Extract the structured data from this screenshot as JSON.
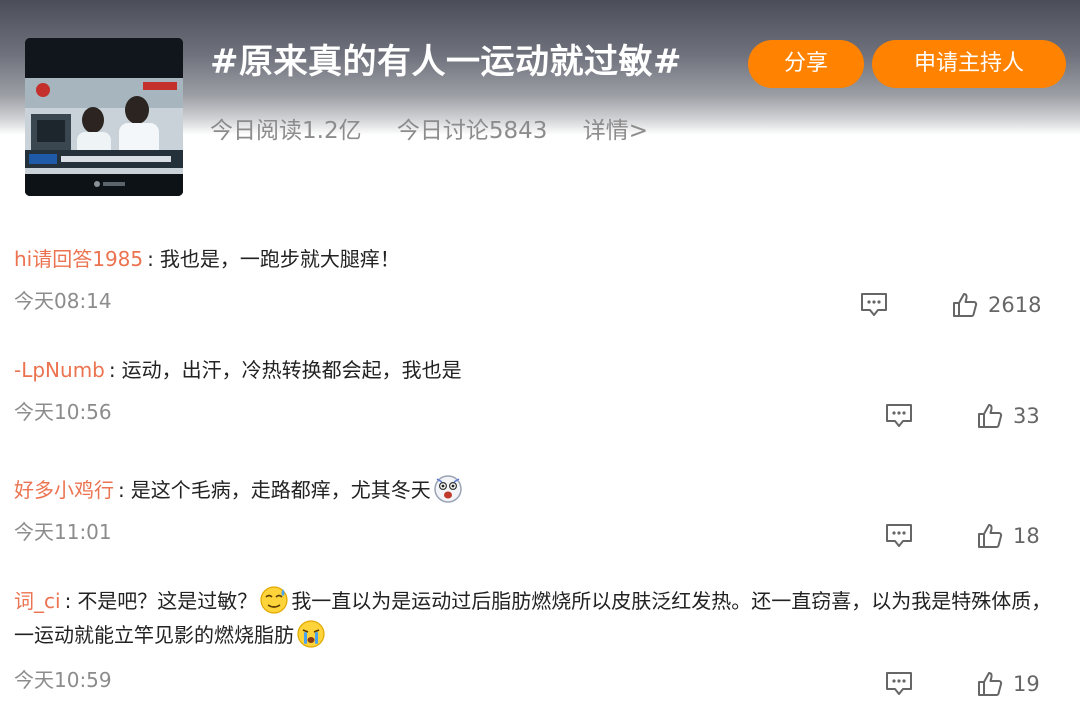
{
  "topic": {
    "title": "#原来真的有人一运动就过敏#",
    "share_label": "分享",
    "apply_host_label": "申请主持人",
    "stats": {
      "reads": "今日阅读1.2亿",
      "discussions": "今日讨论5843",
      "details": "详情>"
    }
  },
  "comments": [
    {
      "user": "hi请回答1985",
      "text": "我也是，一跑步就大腿痒！",
      "time": "今天08:14",
      "likes": "2618"
    },
    {
      "user": "-LpNumb",
      "text": "运动，出汗，冷热转换都会起，我也是",
      "time": "今天10:56",
      "likes": "33"
    },
    {
      "user": "好多小鸡行",
      "text": "是这个毛病，走路都痒，尤其冬天",
      "time": "今天11:01",
      "likes": "18"
    },
    {
      "user": "词_ci",
      "text_part1": "不是吧？这是过敏？",
      "text_part2": "我一直以为是运动过后脂肪燃烧所以皮肤泛红发热。还一直窃喜，以为我是特殊体质，一运动就能立竿见影的燃烧脂肪",
      "time": "今天10:59",
      "likes": "19"
    }
  ],
  "icons": {
    "comment": "comment-bubble-icon",
    "like": "thumbs-up-icon",
    "emoji_shock": "shocked-face-emoji",
    "emoji_sweat": "sweat-face-emoji",
    "emoji_cry": "crying-face-emoji"
  },
  "colors": {
    "accent": "#ff8200",
    "username": "#eb7350",
    "meta": "#8c8c8c"
  }
}
